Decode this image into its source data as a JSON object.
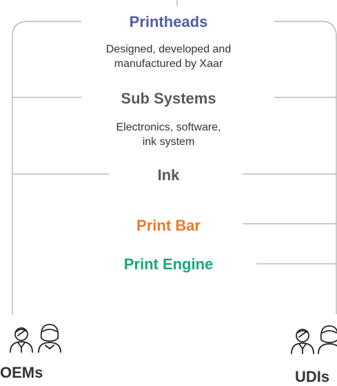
{
  "layers": {
    "printheads": {
      "title": "Printheads",
      "description": "Designed, developed and\nmanufactured by Xaar"
    },
    "sub_systems": {
      "title": "Sub Systems",
      "description": "Electronics, software,\nink system"
    },
    "ink": {
      "title": "Ink"
    },
    "print_bar": {
      "title": "Print Bar"
    },
    "print_engine": {
      "title": "Print Engine"
    }
  },
  "customers": {
    "left": {
      "label": "OEMs",
      "icon": "people-icon"
    },
    "right": {
      "label": "UDIs",
      "icon": "people-icon"
    }
  },
  "colors": {
    "printheads": "#4f5fa5",
    "print_bar": "#e87a2d",
    "print_engine": "#1aa67a",
    "neutral_text": "#595959",
    "lines": "#aaaaaa"
  }
}
